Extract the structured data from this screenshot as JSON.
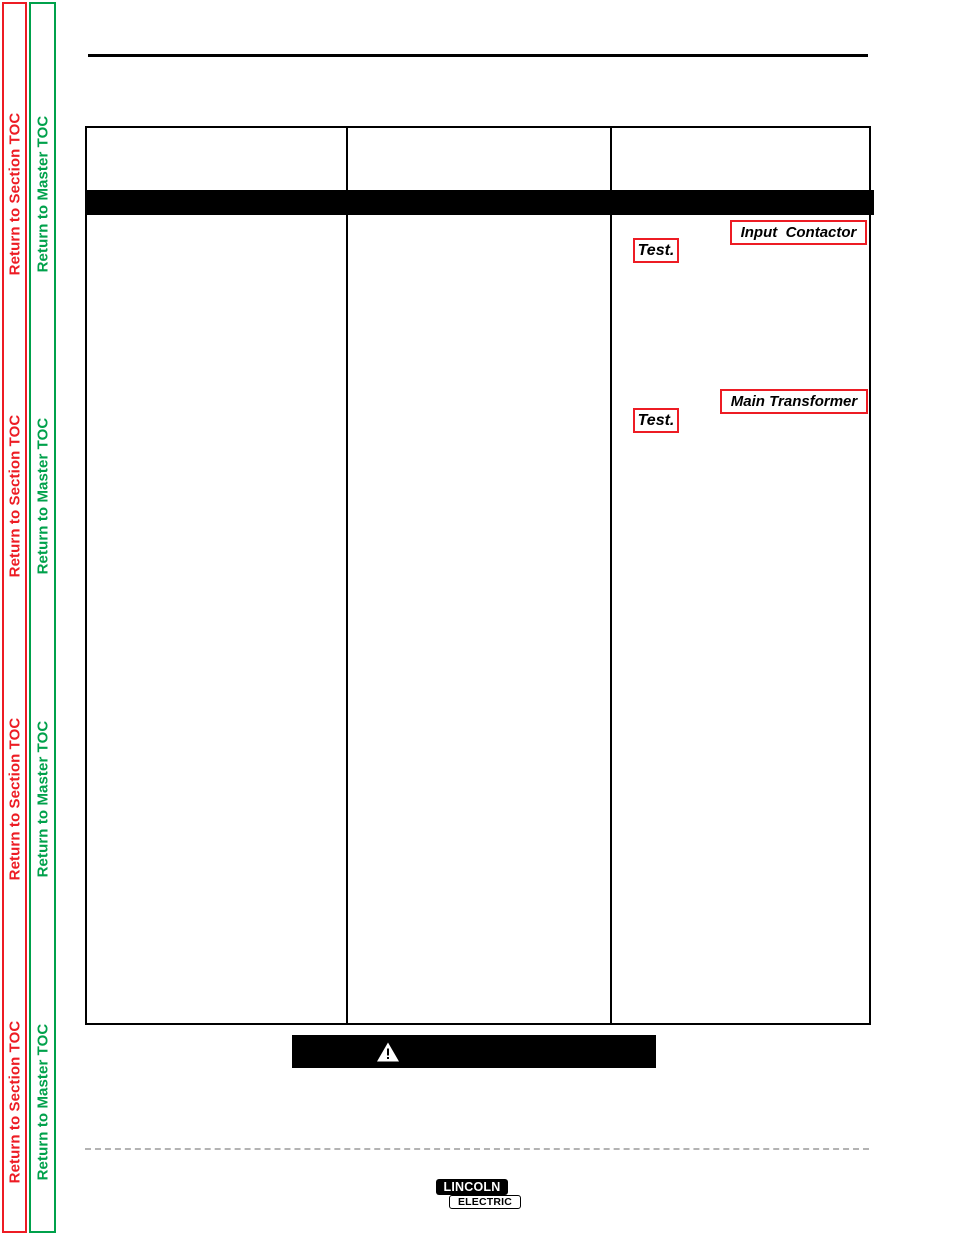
{
  "sidebar": {
    "section_toc": {
      "label": "Return to Section TOC",
      "color": "#ed1c24",
      "repeats": 4
    },
    "master_toc": {
      "label": "Return to Master TOC",
      "color": "#00a14b",
      "repeats": 4
    }
  },
  "table": {
    "columns": [
      {
        "header": ""
      },
      {
        "header": ""
      },
      {
        "header": ""
      }
    ],
    "links": [
      {
        "id": "test-1",
        "label": "Test."
      },
      {
        "id": "input-contactor",
        "label": "Input  Contactor"
      },
      {
        "id": "test-2",
        "label": "Test."
      },
      {
        "id": "main-transformer",
        "label": "Main Transformer"
      }
    ]
  },
  "warning": {
    "icon": "warning-triangle-icon",
    "text": ""
  },
  "logo": {
    "top": "LINCOLN",
    "bottom": "ELECTRIC"
  },
  "colors": {
    "red": "#ed1c24",
    "green": "#00a14b",
    "black": "#000000",
    "dash_gray": "#b3b3b3"
  }
}
